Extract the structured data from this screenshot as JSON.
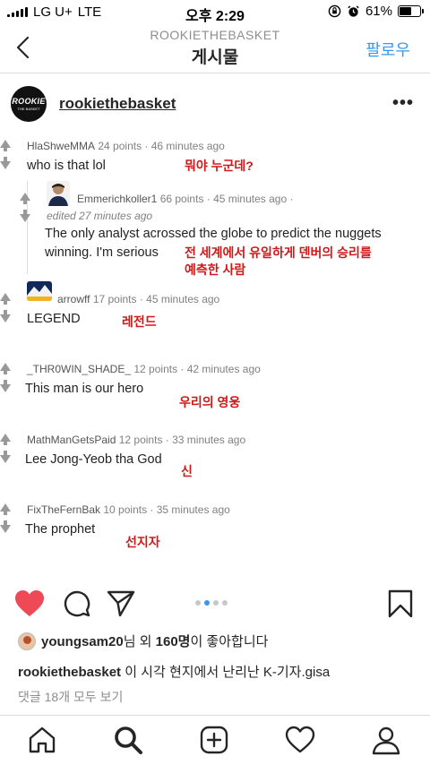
{
  "status_bar": {
    "carrier": "LG U+",
    "network": "LTE",
    "time": "오후 2:29",
    "battery": "61%",
    "battery_level": 0.61
  },
  "nav": {
    "subtitle": "ROOKIETHEBASKET",
    "title": "게시물",
    "follow_label": "팔로우"
  },
  "post": {
    "avatar_text": "ROOKIE",
    "avatar_subtext": "THE BASKET",
    "username": "rookiethebasket",
    "comments": [
      {
        "author": "HlaShweMMA",
        "meta": "24 points · 46 minutes ago",
        "text": "who is that lol",
        "translation": "뭐야 누군데?"
      },
      {
        "author": "Emmerichkoller1",
        "meta": "66 points · 45 minutes ago ·",
        "edited": "edited 27 minutes ago",
        "text_line1": "The only analyst acrossed the globe to predict the nuggets",
        "text_line2": "winning. I'm serious",
        "translation_line1": "전 세계에서 유일하게 덴버의 승리를",
        "translation_line2": "예측한 사람"
      },
      {
        "author": "arrowff",
        "meta": "17 points · 45 minutes ago",
        "text": "LEGEND",
        "translation": "레전드"
      },
      {
        "author": "_THR0WIN_SHADE_",
        "meta": "12 points · 42 minutes ago",
        "text": "This man is our hero",
        "translation": "우리의 영웅"
      },
      {
        "author": "MathManGetsPaid",
        "meta": "12 points · 33 minutes ago",
        "text": "Lee Jong-Yeob tha God",
        "translation": "신"
      },
      {
        "author": "FixTheFernBak",
        "meta": "10 points · 35 minutes ago",
        "text": "The prophet",
        "translation": "선지자"
      }
    ],
    "likes": {
      "user": "youngsam20",
      "mid": "님 외 ",
      "count": "160명",
      "suffix": "이 좋아합니다"
    },
    "caption": {
      "username": "rookiethebasket",
      "text": " 이 시각 현지에서 난리난 K-기자.gisa"
    },
    "view_all_comments": "댓글 18개 모두 보기"
  },
  "colors": {
    "accent_blue": "#3897f0",
    "like_red": "#ed4956",
    "translation_red": "#d01818"
  },
  "icons": [
    "back-chevron-icon",
    "more-icon",
    "heart-icon",
    "comment-icon",
    "share-icon",
    "bookmark-icon",
    "home-icon",
    "search-icon",
    "add-icon",
    "activity-heart-icon",
    "profile-icon"
  ]
}
